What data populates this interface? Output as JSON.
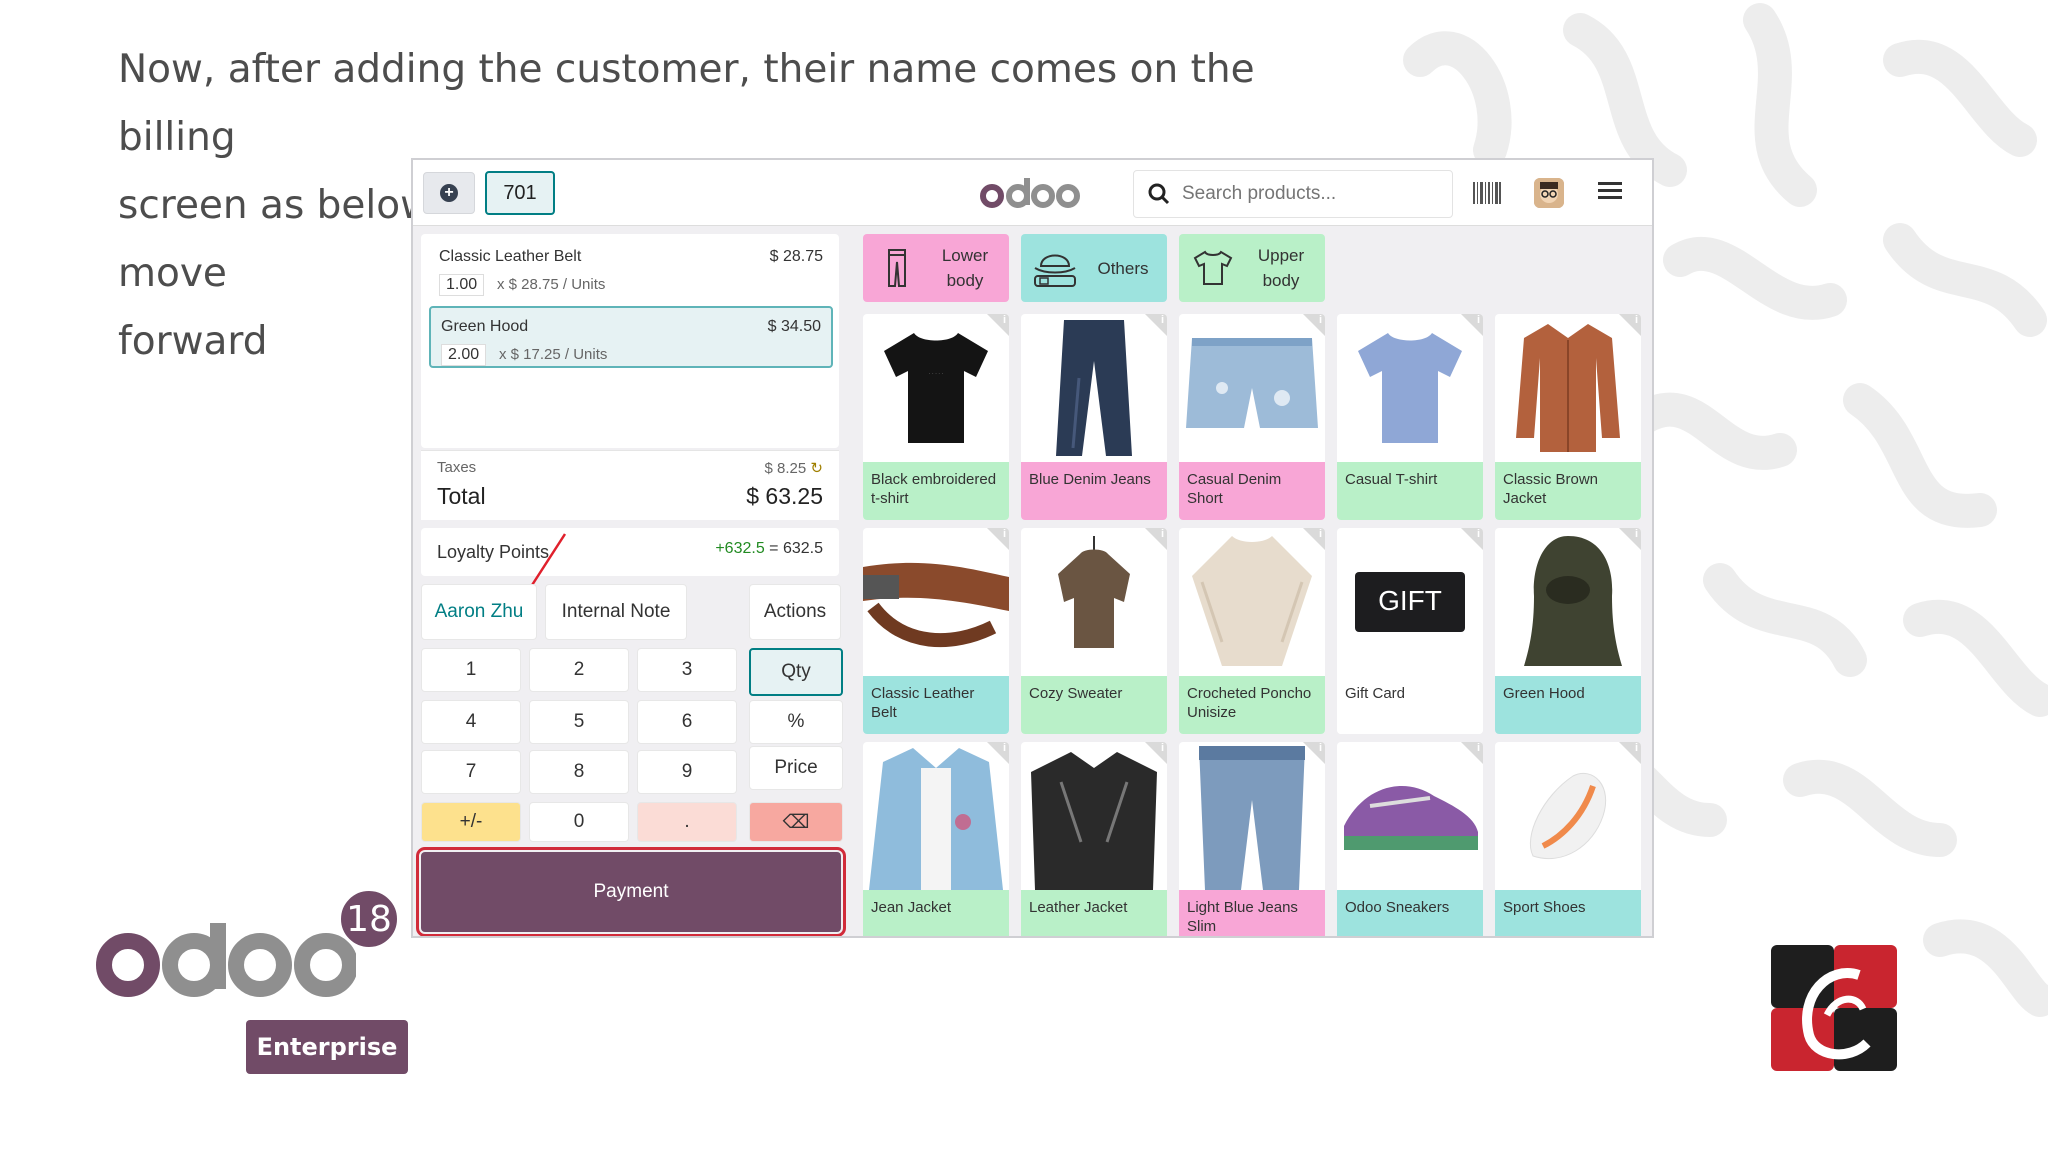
{
  "caption": {
    "line1": "Now, after adding the customer, their name comes on the billing",
    "line2": "screen as below. Now, let’s click on the Payment button to move",
    "line3": "forward"
  },
  "header": {
    "order_number": "701",
    "search_placeholder": "Search products...",
    "icons": [
      "plus-circle-icon",
      "odoo-logo",
      "search-icon",
      "barcode-icon",
      "avatar",
      "hamburger-menu-icon"
    ]
  },
  "order": {
    "lines": [
      {
        "name": "Classic Leather Belt",
        "price": "$ 28.75",
        "qty": "1.00",
        "unit": "x $ 28.75 / Units"
      },
      {
        "name": "Green Hood",
        "price": "$ 34.50",
        "qty": "2.00",
        "unit": "x $ 17.25 / Units"
      }
    ],
    "taxes_label": "Taxes",
    "taxes_value": "$ 8.25",
    "total_label": "Total",
    "total_value": "$ 63.25"
  },
  "loyalty": {
    "label": "Loyalty Points",
    "gain": "+632.5",
    "equals": " = 632.5"
  },
  "actions": {
    "customer": "Aaron Zhu",
    "note": "Internal Note",
    "actions": "Actions"
  },
  "numpad": {
    "keys": [
      "1",
      "2",
      "3",
      "4",
      "5",
      "6",
      "7",
      "8",
      "9",
      "+/-",
      "0",
      "."
    ],
    "modes": [
      "Qty",
      "%",
      "Price"
    ],
    "backspace": "⌫"
  },
  "payment_label": "Payment",
  "categories": [
    {
      "label1": "Lower",
      "label2": "body",
      "icon": "trousers-icon",
      "color": "#f8a6d6"
    },
    {
      "label1": "Others",
      "label2": "",
      "icon": "hat-belt-icon",
      "color": "#9de3de"
    },
    {
      "label1": "Upper",
      "label2": "body",
      "icon": "tshirt-icon",
      "color": "#b9f0c8"
    }
  ],
  "products": [
    {
      "name": "Black embroidered t-shirt",
      "color": "green"
    },
    {
      "name": "Blue Denim Jeans",
      "color": "pink"
    },
    {
      "name": "Casual Denim Short",
      "color": "pink"
    },
    {
      "name": "Casual T-shirt",
      "color": "green"
    },
    {
      "name": "Classic Brown Jacket",
      "color": "green"
    },
    {
      "name": "Classic Leather Belt",
      "color": "teal"
    },
    {
      "name": "Cozy Sweater",
      "color": "green"
    },
    {
      "name": "Crocheted Poncho Unisize",
      "color": "green"
    },
    {
      "name": "Gift Card",
      "color": "none"
    },
    {
      "name": "Green Hood",
      "color": "teal"
    },
    {
      "name": "Jean Jacket",
      "color": "green"
    },
    {
      "name": "Leather Jacket",
      "color": "green"
    },
    {
      "name": "Light Blue Jeans Slim",
      "color": "pink"
    },
    {
      "name": "Odoo Sneakers",
      "color": "teal"
    },
    {
      "name": "Sport Shoes",
      "color": "teal"
    }
  ],
  "gift_card_text": "GIFT",
  "branding": {
    "version": "18",
    "edition": "Enterprise"
  }
}
